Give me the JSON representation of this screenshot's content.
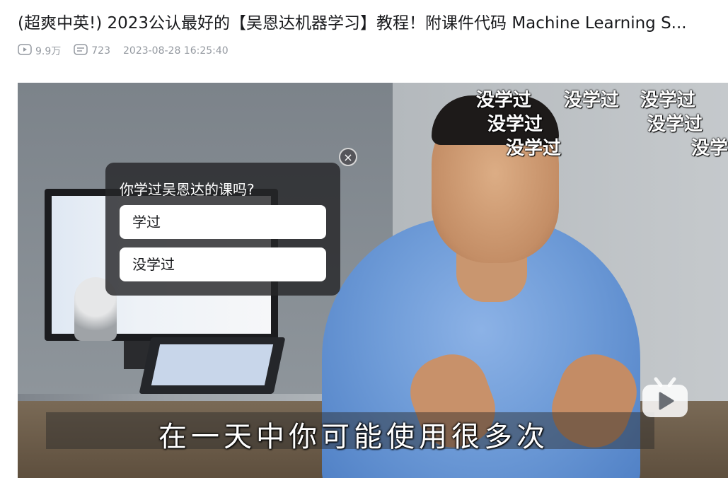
{
  "video": {
    "title": "(超爽中英!) 2023公认最好的【吴恩达机器学习】教程！附课件代码 Machine Learning S...",
    "views": "9.9万",
    "danmaku_count": "723",
    "date": "2023-08-28 16:25:40"
  },
  "player": {
    "subtitle": "在一天中你可能使用很多次",
    "danmaku": [
      "没学过",
      "没学过",
      "没学过",
      "没学过",
      "没学过",
      "没学过",
      "没学"
    ]
  },
  "vote": {
    "question": "你学过吴恩达的课吗?",
    "options": [
      "学过",
      "没学过"
    ],
    "close_symbol": "×"
  },
  "icons": {
    "views": "play-count-icon",
    "danmaku": "danmaku-count-icon",
    "close": "close-icon",
    "logo": "bilibili-tv-icon"
  }
}
